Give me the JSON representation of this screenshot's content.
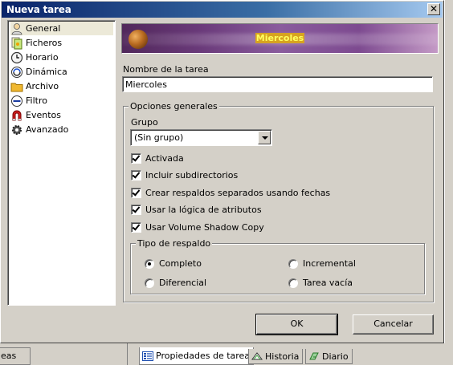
{
  "window": {
    "title": "Nueva tarea",
    "close_label": "✕"
  },
  "nav": {
    "items": [
      {
        "label": "General",
        "icon": "person-icon",
        "selected": true
      },
      {
        "label": "Ficheros",
        "icon": "files-icon"
      },
      {
        "label": "Horario",
        "icon": "clock-icon"
      },
      {
        "label": "Dinámica",
        "icon": "dynamic-icon"
      },
      {
        "label": "Archivo",
        "icon": "folder-icon"
      },
      {
        "label": "Filtro",
        "icon": "filter-icon"
      },
      {
        "label": "Eventos",
        "icon": "magnet-icon"
      },
      {
        "label": "Avanzado",
        "icon": "gears-icon"
      }
    ]
  },
  "banner": {
    "title": "Miercoles"
  },
  "task_name": {
    "label": "Nombre de la tarea",
    "value": "Miercoles"
  },
  "general_options": {
    "title": "Opciones generales",
    "group_label": "Grupo",
    "group_value": "(Sin grupo)",
    "checkboxes": [
      {
        "label": "Activada",
        "checked": true
      },
      {
        "label": "Incluir subdirectorios",
        "checked": true
      },
      {
        "label": "Crear respaldos separados usando fechas",
        "checked": true
      },
      {
        "label": "Usar la lógica de atributos",
        "checked": true
      },
      {
        "label": "Usar Volume Shadow Copy",
        "checked": true
      }
    ]
  },
  "backup_type": {
    "title": "Tipo de respaldo",
    "options": [
      {
        "label": "Completo",
        "checked": true
      },
      {
        "label": "Incremental",
        "checked": false
      },
      {
        "label": "Diferencial",
        "checked": false
      },
      {
        "label": "Tarea vacía",
        "checked": false
      }
    ]
  },
  "buttons": {
    "ok": "OK",
    "cancel": "Cancelar"
  },
  "background": {
    "left_pane_text": "eas",
    "tabs": [
      {
        "label": "Propiedades de tarea",
        "icon": "properties-icon",
        "active": true
      },
      {
        "label": "Historia",
        "icon": "history-icon"
      },
      {
        "label": "Diario",
        "icon": "journal-icon"
      }
    ]
  },
  "colors": {
    "title_bar": "#0a246a",
    "dialog_face": "#d4d0c8",
    "banner_text": "#ffff40",
    "banner_bg": "#6a3a7a"
  }
}
